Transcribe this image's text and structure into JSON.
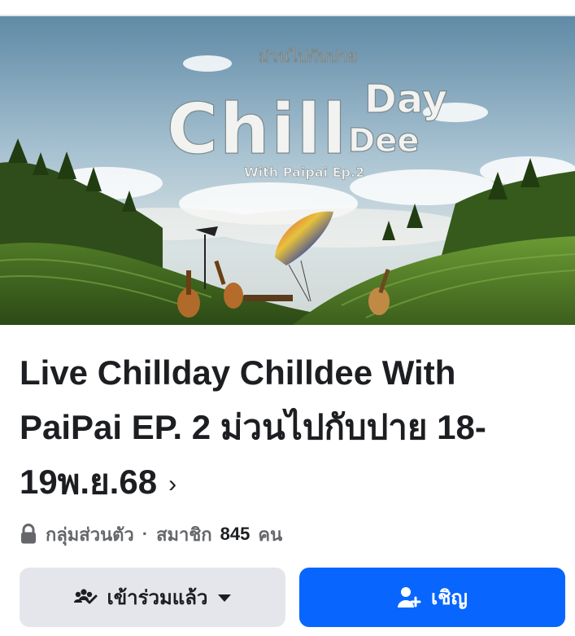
{
  "cover": {
    "logo_small": "ม่วนไปกับปาย",
    "logo_chill": "Chill",
    "logo_day": "Day",
    "logo_dee": "Dee",
    "logo_sub": "With Paipai Ep.2"
  },
  "group": {
    "title": "Live Chillday Chilldee With PaiPai EP. 2 ม่วนไปกับปาย 18-19พ.ย.68",
    "privacy": "กลุ่มส่วนตัว",
    "separator": "·",
    "members_label": "สมาชิก",
    "members_count": "845",
    "members_unit": "คน"
  },
  "actions": {
    "joined_label": "เข้าร่วมแล้ว",
    "invite_label": "เชิญ"
  },
  "icons": {
    "lock": "lock-icon",
    "joined": "group-joined-icon",
    "dropdown": "caret-down-icon",
    "invite": "add-person-icon",
    "chevron": "chevron-right-icon"
  },
  "colors": {
    "invite_button": "#0866ff",
    "joined_button": "#e4e6eb",
    "text_primary": "#1c1e21",
    "text_secondary": "#65676b"
  }
}
